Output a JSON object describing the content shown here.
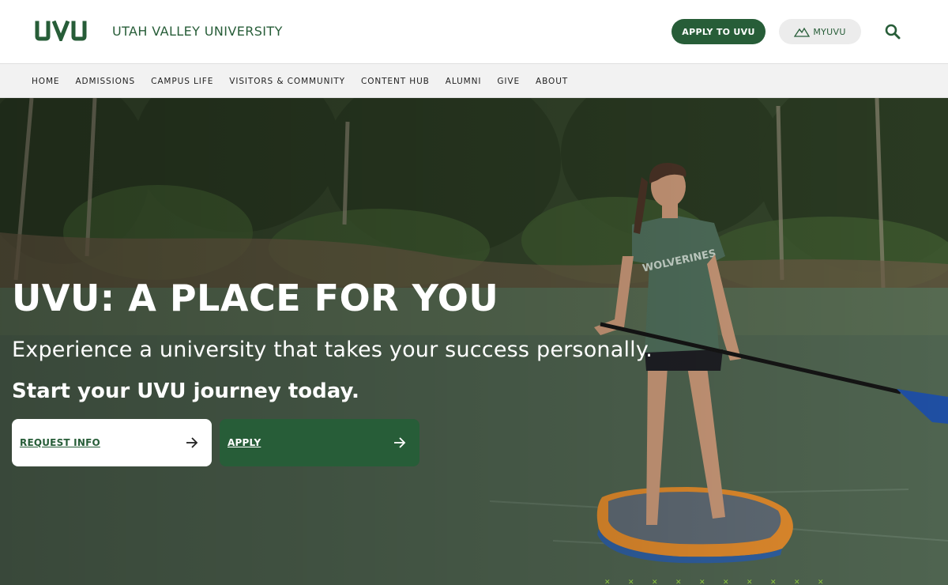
{
  "header": {
    "logo_text": "UVU",
    "site_name": "UTAH VALLEY UNIVERSITY",
    "apply_label": "APPLY TO UVU",
    "myuvu_label": "MYUVU",
    "myuvu_icon": "mountain-icon",
    "search_icon": "search-icon"
  },
  "nav": {
    "items": [
      {
        "label": "HOME"
      },
      {
        "label": "ADMISSIONS"
      },
      {
        "label": "CAMPUS LIFE"
      },
      {
        "label": "VISITORS & COMMUNITY"
      },
      {
        "label": "CONTENT HUB"
      },
      {
        "label": "ALUMNI"
      },
      {
        "label": "GIVE"
      },
      {
        "label": "ABOUT"
      }
    ]
  },
  "hero": {
    "title": "UVU: A PLACE FOR YOU",
    "subtitle": "Experience a university that takes your success personally.",
    "cta_text": "Start your UVU journey today.",
    "buttons": [
      {
        "label": "REQUEST INFO",
        "icon": "arrow-right-icon"
      },
      {
        "label": "APPLY",
        "icon": "arrow-right-icon"
      }
    ],
    "image": "woman paddleboarding on lake"
  },
  "colors": {
    "brand_green": "#275d38",
    "accent_green": "#8dc63f",
    "nav_bg": "#f2f2f2",
    "pill_gray": "#ececec"
  }
}
